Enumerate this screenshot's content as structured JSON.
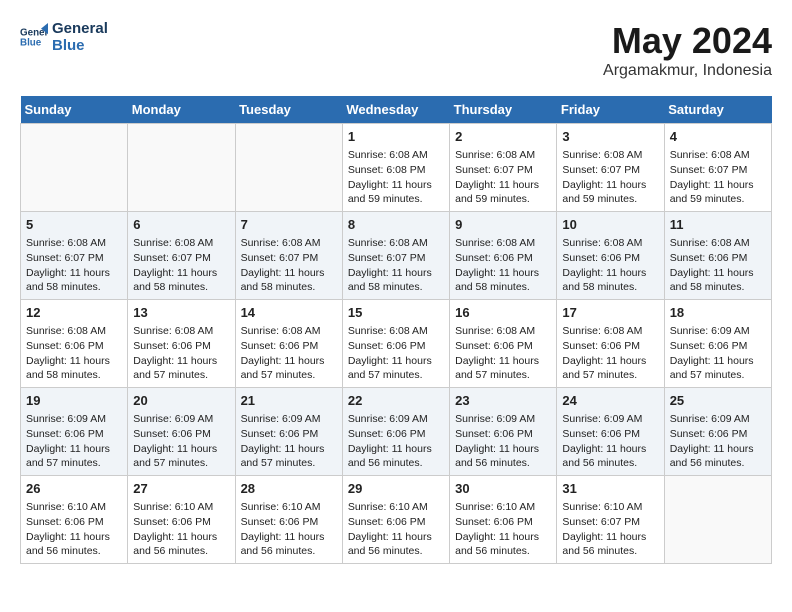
{
  "header": {
    "logo_line1": "General",
    "logo_line2": "Blue",
    "month_year": "May 2024",
    "location": "Argamakmur, Indonesia"
  },
  "days_of_week": [
    "Sunday",
    "Monday",
    "Tuesday",
    "Wednesday",
    "Thursday",
    "Friday",
    "Saturday"
  ],
  "weeks": [
    [
      {
        "day": "",
        "lines": []
      },
      {
        "day": "",
        "lines": []
      },
      {
        "day": "",
        "lines": []
      },
      {
        "day": "1",
        "lines": [
          "Sunrise: 6:08 AM",
          "Sunset: 6:08 PM",
          "Daylight: 11 hours",
          "and 59 minutes."
        ]
      },
      {
        "day": "2",
        "lines": [
          "Sunrise: 6:08 AM",
          "Sunset: 6:07 PM",
          "Daylight: 11 hours",
          "and 59 minutes."
        ]
      },
      {
        "day": "3",
        "lines": [
          "Sunrise: 6:08 AM",
          "Sunset: 6:07 PM",
          "Daylight: 11 hours",
          "and 59 minutes."
        ]
      },
      {
        "day": "4",
        "lines": [
          "Sunrise: 6:08 AM",
          "Sunset: 6:07 PM",
          "Daylight: 11 hours",
          "and 59 minutes."
        ]
      }
    ],
    [
      {
        "day": "5",
        "lines": [
          "Sunrise: 6:08 AM",
          "Sunset: 6:07 PM",
          "Daylight: 11 hours",
          "and 58 minutes."
        ]
      },
      {
        "day": "6",
        "lines": [
          "Sunrise: 6:08 AM",
          "Sunset: 6:07 PM",
          "Daylight: 11 hours",
          "and 58 minutes."
        ]
      },
      {
        "day": "7",
        "lines": [
          "Sunrise: 6:08 AM",
          "Sunset: 6:07 PM",
          "Daylight: 11 hours",
          "and 58 minutes."
        ]
      },
      {
        "day": "8",
        "lines": [
          "Sunrise: 6:08 AM",
          "Sunset: 6:07 PM",
          "Daylight: 11 hours",
          "and 58 minutes."
        ]
      },
      {
        "day": "9",
        "lines": [
          "Sunrise: 6:08 AM",
          "Sunset: 6:06 PM",
          "Daylight: 11 hours",
          "and 58 minutes."
        ]
      },
      {
        "day": "10",
        "lines": [
          "Sunrise: 6:08 AM",
          "Sunset: 6:06 PM",
          "Daylight: 11 hours",
          "and 58 minutes."
        ]
      },
      {
        "day": "11",
        "lines": [
          "Sunrise: 6:08 AM",
          "Sunset: 6:06 PM",
          "Daylight: 11 hours",
          "and 58 minutes."
        ]
      }
    ],
    [
      {
        "day": "12",
        "lines": [
          "Sunrise: 6:08 AM",
          "Sunset: 6:06 PM",
          "Daylight: 11 hours",
          "and 58 minutes."
        ]
      },
      {
        "day": "13",
        "lines": [
          "Sunrise: 6:08 AM",
          "Sunset: 6:06 PM",
          "Daylight: 11 hours",
          "and 57 minutes."
        ]
      },
      {
        "day": "14",
        "lines": [
          "Sunrise: 6:08 AM",
          "Sunset: 6:06 PM",
          "Daylight: 11 hours",
          "and 57 minutes."
        ]
      },
      {
        "day": "15",
        "lines": [
          "Sunrise: 6:08 AM",
          "Sunset: 6:06 PM",
          "Daylight: 11 hours",
          "and 57 minutes."
        ]
      },
      {
        "day": "16",
        "lines": [
          "Sunrise: 6:08 AM",
          "Sunset: 6:06 PM",
          "Daylight: 11 hours",
          "and 57 minutes."
        ]
      },
      {
        "day": "17",
        "lines": [
          "Sunrise: 6:08 AM",
          "Sunset: 6:06 PM",
          "Daylight: 11 hours",
          "and 57 minutes."
        ]
      },
      {
        "day": "18",
        "lines": [
          "Sunrise: 6:09 AM",
          "Sunset: 6:06 PM",
          "Daylight: 11 hours",
          "and 57 minutes."
        ]
      }
    ],
    [
      {
        "day": "19",
        "lines": [
          "Sunrise: 6:09 AM",
          "Sunset: 6:06 PM",
          "Daylight: 11 hours",
          "and 57 minutes."
        ]
      },
      {
        "day": "20",
        "lines": [
          "Sunrise: 6:09 AM",
          "Sunset: 6:06 PM",
          "Daylight: 11 hours",
          "and 57 minutes."
        ]
      },
      {
        "day": "21",
        "lines": [
          "Sunrise: 6:09 AM",
          "Sunset: 6:06 PM",
          "Daylight: 11 hours",
          "and 57 minutes."
        ]
      },
      {
        "day": "22",
        "lines": [
          "Sunrise: 6:09 AM",
          "Sunset: 6:06 PM",
          "Daylight: 11 hours",
          "and 56 minutes."
        ]
      },
      {
        "day": "23",
        "lines": [
          "Sunrise: 6:09 AM",
          "Sunset: 6:06 PM",
          "Daylight: 11 hours",
          "and 56 minutes."
        ]
      },
      {
        "day": "24",
        "lines": [
          "Sunrise: 6:09 AM",
          "Sunset: 6:06 PM",
          "Daylight: 11 hours",
          "and 56 minutes."
        ]
      },
      {
        "day": "25",
        "lines": [
          "Sunrise: 6:09 AM",
          "Sunset: 6:06 PM",
          "Daylight: 11 hours",
          "and 56 minutes."
        ]
      }
    ],
    [
      {
        "day": "26",
        "lines": [
          "Sunrise: 6:10 AM",
          "Sunset: 6:06 PM",
          "Daylight: 11 hours",
          "and 56 minutes."
        ]
      },
      {
        "day": "27",
        "lines": [
          "Sunrise: 6:10 AM",
          "Sunset: 6:06 PM",
          "Daylight: 11 hours",
          "and 56 minutes."
        ]
      },
      {
        "day": "28",
        "lines": [
          "Sunrise: 6:10 AM",
          "Sunset: 6:06 PM",
          "Daylight: 11 hours",
          "and 56 minutes."
        ]
      },
      {
        "day": "29",
        "lines": [
          "Sunrise: 6:10 AM",
          "Sunset: 6:06 PM",
          "Daylight: 11 hours",
          "and 56 minutes."
        ]
      },
      {
        "day": "30",
        "lines": [
          "Sunrise: 6:10 AM",
          "Sunset: 6:06 PM",
          "Daylight: 11 hours",
          "and 56 minutes."
        ]
      },
      {
        "day": "31",
        "lines": [
          "Sunrise: 6:10 AM",
          "Sunset: 6:07 PM",
          "Daylight: 11 hours",
          "and 56 minutes."
        ]
      },
      {
        "day": "",
        "lines": []
      }
    ]
  ]
}
